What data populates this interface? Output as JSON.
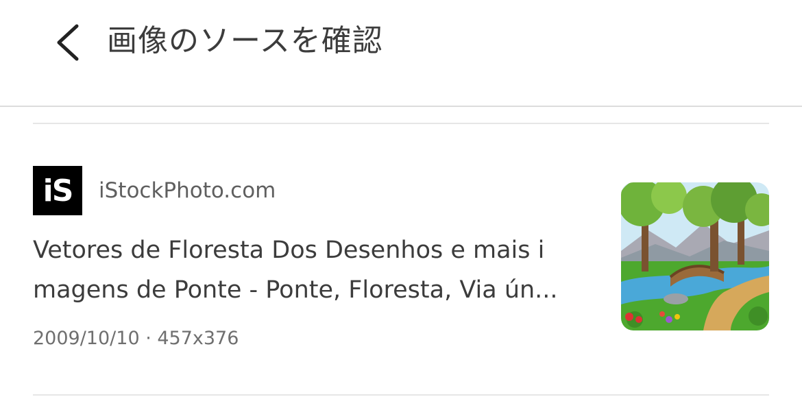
{
  "header": {
    "title": "画像のソースを確認",
    "back_icon": "chevron-left-icon"
  },
  "result": {
    "source_logo_text": "iS",
    "source_domain": "iStockPhoto.com",
    "title_line1": "Vetores de Floresta Dos Desenhos e mais i",
    "title_line2": "magens de Ponte - Ponte, Floresta, Via ún...",
    "meta": "2009/10/10 · 457x376",
    "thumbnail": "forest-bridge-cartoon-image"
  },
  "colors": {
    "text_primary": "#3c3c3c",
    "text_secondary": "#5f5f5f",
    "divider": "#e6e6e6"
  }
}
